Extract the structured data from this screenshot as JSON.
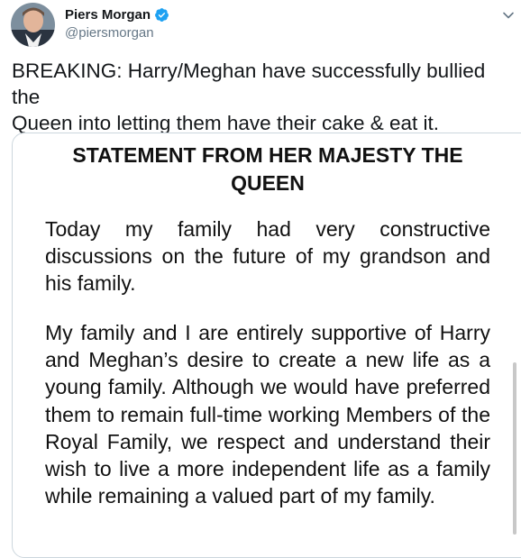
{
  "author": {
    "display_name": "Piers Morgan",
    "handle": "@piersmorgan",
    "avatar": "avatar-photo",
    "verified_icon": "verified-badge-icon",
    "verified_color": "#1da1f2"
  },
  "menu_icon": "chevron-down-icon",
  "tweet": {
    "text": "BREAKING: Harry/Meghan have successfully bullied the\nQueen into letting them have their cake & eat it."
  },
  "media": {
    "title": "STATEMENT FROM HER MAJESTY THE\nQUEEN",
    "paragraphs": [
      "Today my family had very constructive discussions on the future of my grandson and his family.",
      "My family and I are entirely supportive of Harry and Meghan’s desire to create a new life as a young family. Although we would have preferred them to remain full-time working Members of the Royal Family, we respect and understand their wish to live a more independent life as a family while remaining a valued part of my family."
    ]
  },
  "colors": {
    "text": "#14171a",
    "secondary": "#657786",
    "border": "#ccd6dd"
  }
}
